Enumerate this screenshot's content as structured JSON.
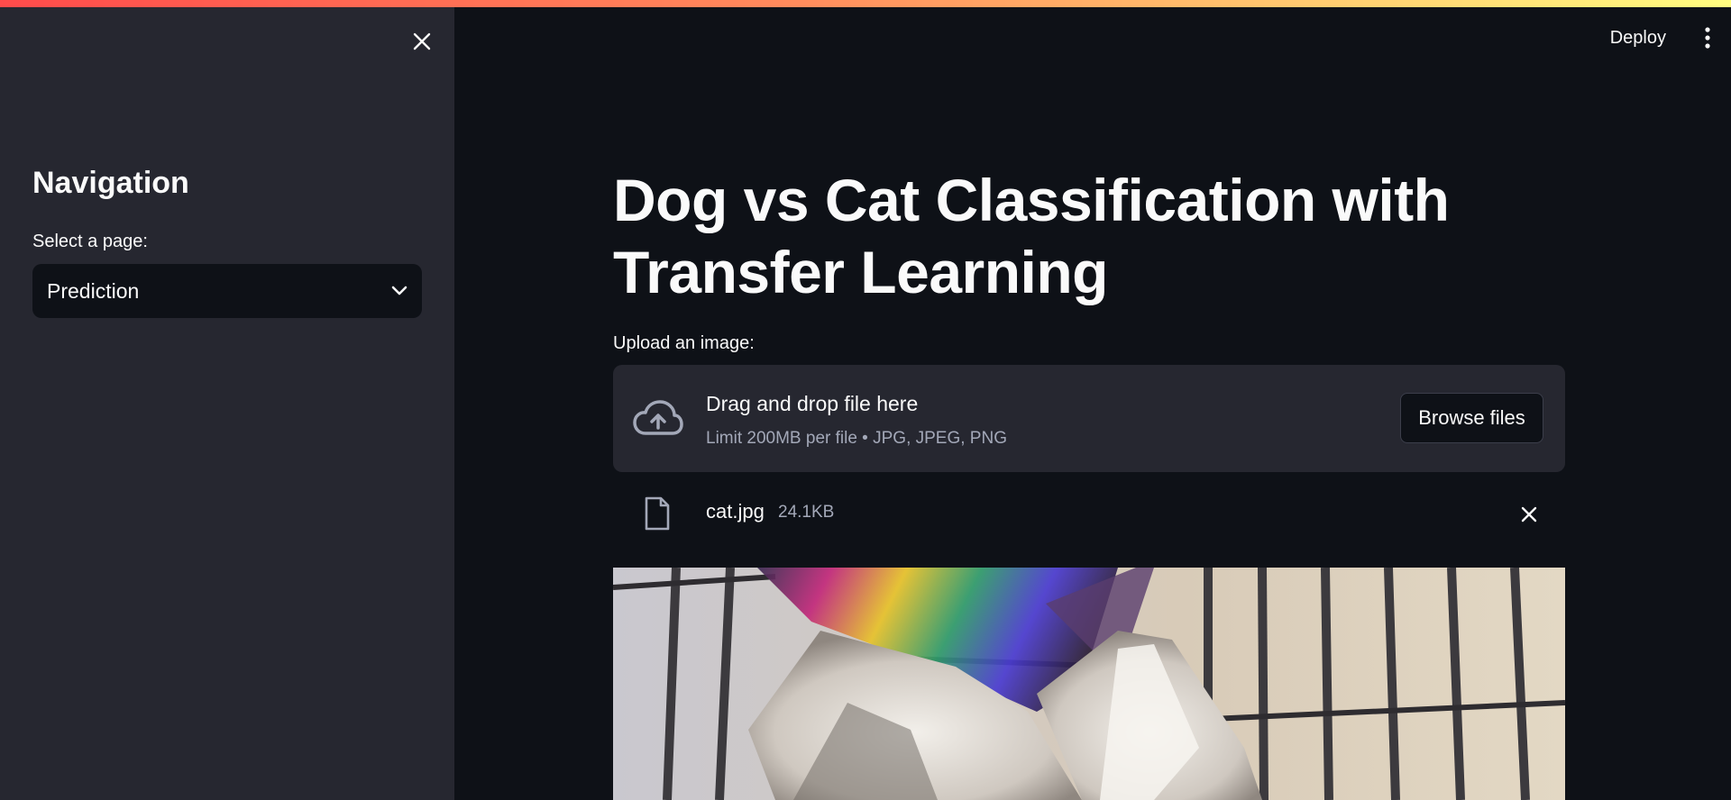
{
  "sidebar": {
    "heading": "Navigation",
    "select_label": "Select a page:",
    "select_value": "Prediction"
  },
  "header": {
    "deploy_label": "Deploy"
  },
  "main": {
    "title": "Dog vs Cat Classification with Transfer Learning",
    "upload_label": "Upload an image:",
    "dropzone": {
      "title": "Drag and drop file here",
      "subtitle": "Limit 200MB per file • JPG, JPEG, PNG",
      "browse_label": "Browse files"
    },
    "file": {
      "name": "cat.jpg",
      "size": "24.1KB"
    }
  },
  "colors": {
    "background": "#0e1117",
    "sidebar": "#262730",
    "accent_gradient_start": "#ff4b4b",
    "accent_gradient_end": "#fffd80",
    "muted_text": "#a3a8b8"
  },
  "icons": [
    "close-icon",
    "chevron-down-icon",
    "kebab-menu-icon",
    "cloud-upload-icon",
    "file-icon",
    "remove-file-icon"
  ]
}
